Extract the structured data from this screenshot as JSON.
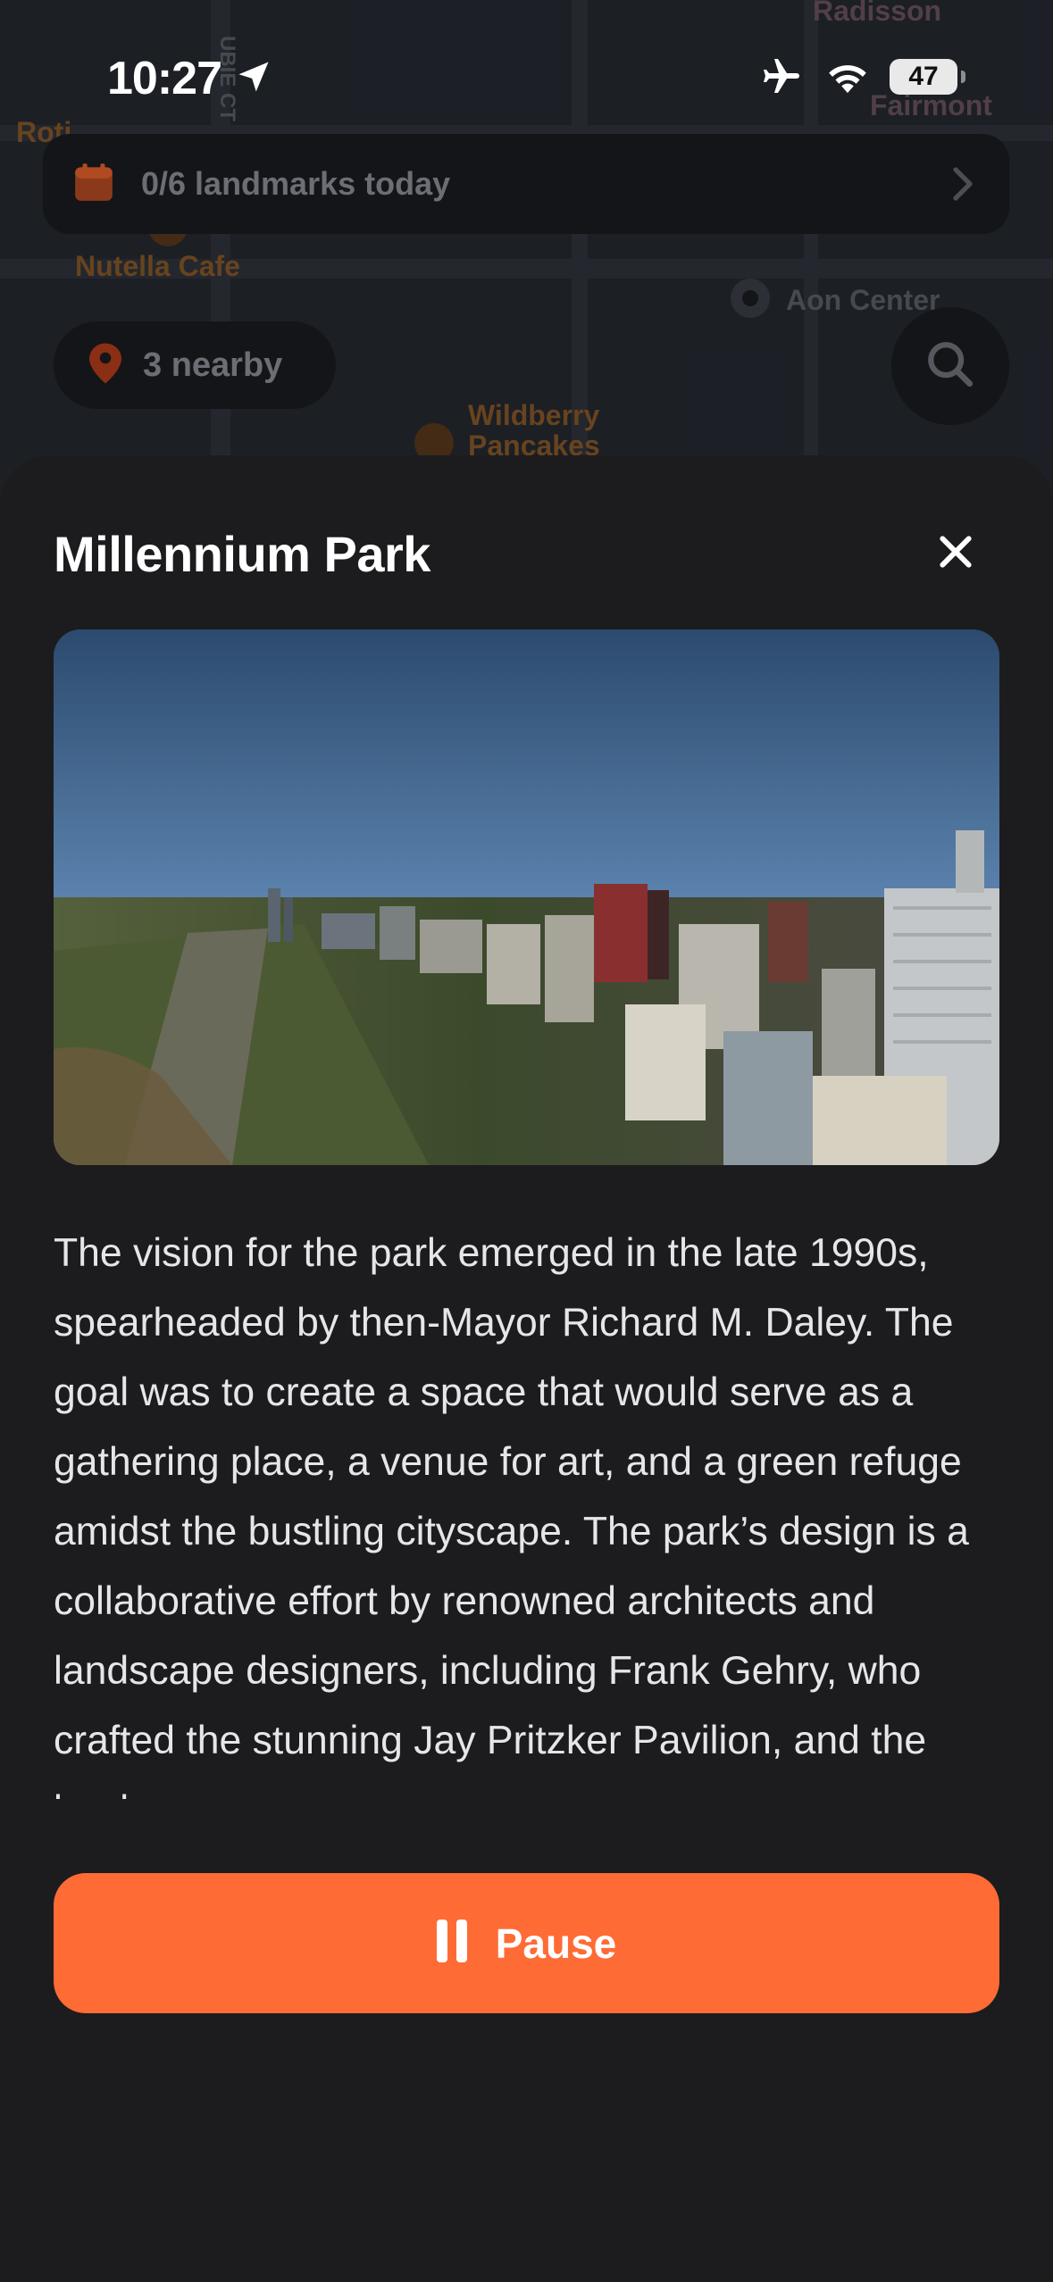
{
  "status_bar": {
    "time": "10:27",
    "battery": "47"
  },
  "map": {
    "labels": {
      "roti": "Roti",
      "street": "UBIE CT",
      "nutella": "Nutella Cafe",
      "aon": "Aon Center",
      "wildberry": "Wildberry Pancakes",
      "radisson": "Radisson",
      "fairmont": "Fairmont"
    },
    "landmarks_banner": "0/6 landmarks today",
    "nearby": "3 nearby"
  },
  "sheet": {
    "title": "Millennium Park",
    "description": "The vision for the park emerged in the late 1990s, spearheaded by then-Mayor Richard M. Daley. The goal was to create a space that would serve as a gathering place, a venue for art, and a green refuge amidst the bustling cityscape. The park’s design is a collaborative effort by renowned architects and landscape designers, including Frank Gehry, who crafted the stunning Jay Pritzker Pavilion, and the landscape",
    "pause_label": "Pause"
  },
  "colors": {
    "accent": "#ff6b35",
    "sheet_bg": "#1c1c1e",
    "map_bg": "#262a31"
  },
  "icons": {
    "location": "location-arrow-icon",
    "airplane": "airplane-icon",
    "wifi": "wifi-icon",
    "calendar": "calendar-icon",
    "chevron": "chevron-right-icon",
    "pin": "map-pin-icon",
    "search": "search-icon",
    "close": "close-icon",
    "pause": "pause-icon"
  }
}
